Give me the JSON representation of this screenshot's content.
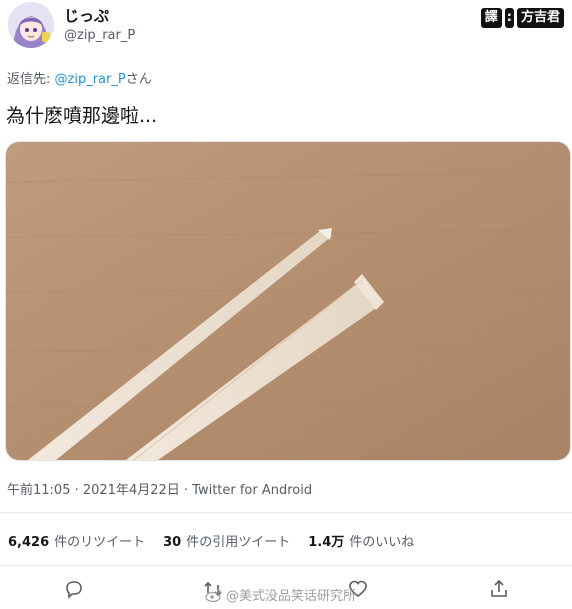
{
  "user": {
    "display_name": "じっぷ",
    "handle": "@zip_rar_P"
  },
  "credit": {
    "label_translate": "譯",
    "label_separator": ":",
    "translator": "方吉君"
  },
  "reply": {
    "prefix": "返信先: ",
    "mention": "@zip_rar_P",
    "suffix": "さん"
  },
  "tweet": {
    "text": "為什麽噴那邊啦..."
  },
  "meta": {
    "timestamp": "午前11:05 · 2021年4月22日 · Twitter for Android"
  },
  "stats": {
    "retweets": {
      "count": "6,426",
      "label": "件のリツイート"
    },
    "quotes": {
      "count": "30",
      "label": "件の引用ツイート"
    },
    "likes": {
      "count": "1.4万",
      "label": "件のいいね"
    }
  },
  "actions": [
    "reply-icon",
    "retweet-icon",
    "like-icon",
    "share-icon"
  ],
  "watermark": {
    "text": "@美式没品笑话研究所"
  },
  "colors": {
    "accent": "#1b95e0",
    "secondary_text": "#555d66"
  }
}
